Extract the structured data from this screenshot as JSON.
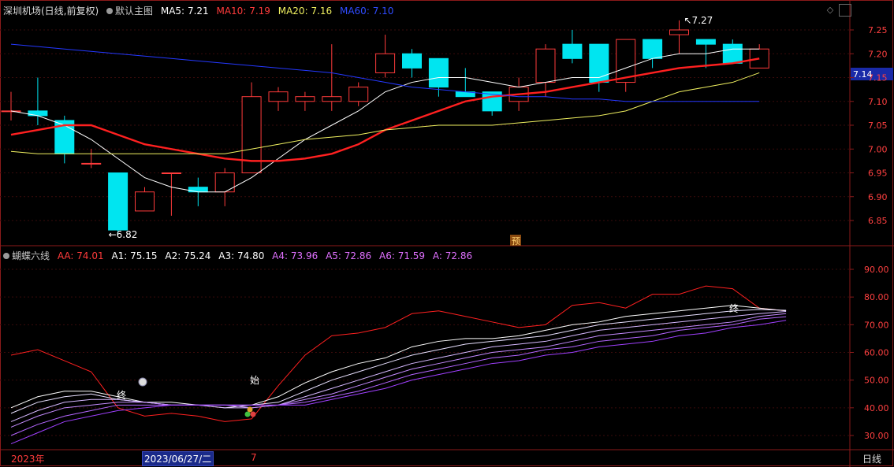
{
  "header": {
    "stock_title": "深圳机场(日线,前复权)",
    "main_chart_label": "默认主图",
    "ma": [
      {
        "label": "MA5:",
        "value": "7.21",
        "color": "#ffffff"
      },
      {
        "label": "MA10:",
        "value": "7.19",
        "color": "#ff3b3b"
      },
      {
        "label": "MA20:",
        "value": "7.16",
        "color": "#f0f060"
      },
      {
        "label": "MA60:",
        "value": "7.10",
        "color": "#2f4bff"
      }
    ]
  },
  "indicator": {
    "name": "蝴蝶六线",
    "values": [
      {
        "label": "AA:",
        "value": "74.01",
        "color": "#ff3b3b"
      },
      {
        "label": "A1:",
        "value": "75.15",
        "color": "#ffffff"
      },
      {
        "label": "A2:",
        "value": "75.24",
        "color": "#ffffff"
      },
      {
        "label": "A3:",
        "value": "74.80",
        "color": "#ffffff"
      },
      {
        "label": "A4:",
        "value": "73.96",
        "color": "#e070ff"
      },
      {
        "label": "A5:",
        "value": "72.86",
        "color": "#e070ff"
      },
      {
        "label": "A6:",
        "value": "71.59",
        "color": "#e070ff"
      },
      {
        "label": "A:",
        "value": "72.86",
        "color": "#e070ff"
      }
    ]
  },
  "footer": {
    "year_label": "2023年",
    "cursor_date": "2023/06/27/二",
    "month_label": "7",
    "period_button": "日线"
  },
  "colors": {
    "up": "#ff3b3b",
    "down": "#00e5f0",
    "ma5": "#ffffff",
    "ma10": "#ff2020",
    "ma20": "#f0f060",
    "ma60": "#2438ff",
    "frame": "#8b1a1a"
  },
  "chart_data": [
    {
      "type": "candlestick",
      "ylim": [
        6.8,
        7.28
      ],
      "yticks": [
        "7.25",
        "7.20",
        "7.15",
        "7.10",
        "7.05",
        "7.00",
        "6.95",
        "6.90",
        "6.85"
      ],
      "current_price_label": "7.14",
      "annotations": {
        "high": "7.27",
        "low": "6.82",
        "forecast_tag": "预"
      },
      "candles": [
        {
          "o": 7.08,
          "h": 7.12,
          "l": 7.06,
          "c": 7.08
        },
        {
          "o": 7.08,
          "h": 7.15,
          "l": 7.05,
          "c": 7.07
        },
        {
          "o": 7.06,
          "h": 7.07,
          "l": 6.97,
          "c": 6.99
        },
        {
          "o": 6.97,
          "h": 7.0,
          "l": 6.96,
          "c": 6.97
        },
        {
          "o": 6.95,
          "h": 6.95,
          "l": 6.82,
          "c": 6.83
        },
        {
          "o": 6.87,
          "h": 6.92,
          "l": 6.87,
          "c": 6.91
        },
        {
          "o": 6.95,
          "h": 6.95,
          "l": 6.86,
          "c": 6.95
        },
        {
          "o": 6.92,
          "h": 6.94,
          "l": 6.88,
          "c": 6.91
        },
        {
          "o": 6.91,
          "h": 6.96,
          "l": 6.88,
          "c": 6.95
        },
        {
          "o": 6.95,
          "h": 7.14,
          "l": 6.95,
          "c": 7.11
        },
        {
          "o": 7.1,
          "h": 7.13,
          "l": 7.08,
          "c": 7.12
        },
        {
          "o": 7.1,
          "h": 7.12,
          "l": 7.08,
          "c": 7.11
        },
        {
          "o": 7.1,
          "h": 7.22,
          "l": 7.08,
          "c": 7.11
        },
        {
          "o": 7.1,
          "h": 7.14,
          "l": 7.09,
          "c": 7.13
        },
        {
          "o": 7.16,
          "h": 7.24,
          "l": 7.15,
          "c": 7.2
        },
        {
          "o": 7.2,
          "h": 7.21,
          "l": 7.15,
          "c": 7.17
        },
        {
          "o": 7.19,
          "h": 7.19,
          "l": 7.11,
          "c": 7.13
        },
        {
          "o": 7.12,
          "h": 7.17,
          "l": 7.11,
          "c": 7.11
        },
        {
          "o": 7.12,
          "h": 7.12,
          "l": 7.07,
          "c": 7.08
        },
        {
          "o": 7.1,
          "h": 7.15,
          "l": 7.08,
          "c": 7.13
        },
        {
          "o": 7.14,
          "h": 7.22,
          "l": 7.11,
          "c": 7.21
        },
        {
          "o": 7.22,
          "h": 7.25,
          "l": 7.18,
          "c": 7.19
        },
        {
          "o": 7.22,
          "h": 7.22,
          "l": 7.12,
          "c": 7.14
        },
        {
          "o": 7.14,
          "h": 7.23,
          "l": 7.12,
          "c": 7.23
        },
        {
          "o": 7.23,
          "h": 7.23,
          "l": 7.17,
          "c": 7.19
        },
        {
          "o": 7.24,
          "h": 7.27,
          "l": 7.2,
          "c": 7.25
        },
        {
          "o": 7.23,
          "h": 7.23,
          "l": 7.17,
          "c": 7.22
        },
        {
          "o": 7.22,
          "h": 7.23,
          "l": 7.18,
          "c": 7.18
        },
        {
          "o": 7.17,
          "h": 7.22,
          "l": 7.17,
          "c": 7.21
        }
      ],
      "ma_series": [
        {
          "name": "MA5",
          "values": [
            7.08,
            7.07,
            7.05,
            7.02,
            6.98,
            6.94,
            6.92,
            6.91,
            6.91,
            6.94,
            6.98,
            7.02,
            7.05,
            7.08,
            7.12,
            7.14,
            7.15,
            7.15,
            7.14,
            7.13,
            7.14,
            7.15,
            7.15,
            7.17,
            7.19,
            7.2,
            7.2,
            7.21,
            7.21
          ]
        },
        {
          "name": "MA10",
          "values": [
            7.03,
            7.04,
            7.05,
            7.05,
            7.03,
            7.01,
            7.0,
            6.99,
            6.98,
            6.975,
            6.975,
            6.98,
            6.99,
            7.01,
            7.04,
            7.06,
            7.08,
            7.1,
            7.11,
            7.115,
            7.12,
            7.13,
            7.14,
            7.15,
            7.16,
            7.17,
            7.175,
            7.18,
            7.19
          ]
        },
        {
          "name": "MA20",
          "values": [
            6.995,
            6.99,
            6.99,
            6.99,
            6.99,
            6.99,
            6.99,
            6.99,
            6.99,
            7.0,
            7.01,
            7.02,
            7.025,
            7.03,
            7.04,
            7.045,
            7.05,
            7.05,
            7.05,
            7.055,
            7.06,
            7.065,
            7.07,
            7.08,
            7.1,
            7.12,
            7.13,
            7.14,
            7.16
          ]
        },
        {
          "name": "MA60",
          "values": [
            7.22,
            7.215,
            7.21,
            7.205,
            7.2,
            7.195,
            7.19,
            7.185,
            7.18,
            7.175,
            7.17,
            7.165,
            7.16,
            7.15,
            7.14,
            7.13,
            7.125,
            7.12,
            7.115,
            7.11,
            7.11,
            7.105,
            7.105,
            7.1,
            7.1,
            7.1,
            7.1,
            7.1,
            7.1
          ]
        }
      ]
    },
    {
      "type": "line",
      "ylim": [
        25,
        97
      ],
      "yticks": [
        "90.00",
        "80.00",
        "70.00",
        "60.00",
        "50.00",
        "40.00",
        "30.00"
      ],
      "annotations": {
        "end1": "终",
        "start": "始",
        "end2": "终"
      },
      "series": [
        {
          "name": "AA",
          "values": [
            59,
            61,
            57,
            53,
            40,
            37,
            38,
            37,
            35,
            36,
            48,
            59,
            66,
            67,
            69,
            74,
            75,
            73,
            71,
            69,
            70,
            77,
            78,
            76,
            81,
            81,
            84,
            83,
            76,
            75
          ]
        },
        {
          "name": "A1",
          "values": [
            40,
            44,
            46,
            46,
            44,
            42,
            42,
            41,
            40,
            41,
            44,
            49,
            53,
            56,
            58,
            62,
            64,
            65,
            65,
            66,
            68,
            70,
            71,
            73,
            74,
            75,
            76,
            77,
            76,
            75
          ]
        },
        {
          "name": "A2",
          "values": [
            38,
            42,
            44,
            45,
            43,
            42,
            41,
            41,
            41,
            41,
            42,
            46,
            50,
            53,
            56,
            59,
            61,
            63,
            64,
            65,
            66,
            68,
            70,
            71,
            72,
            73,
            74,
            75,
            75.5,
            75.2
          ]
        },
        {
          "name": "A3",
          "values": [
            35,
            39,
            42,
            43,
            43,
            42,
            41,
            41,
            40,
            40,
            41,
            44,
            47,
            50,
            53,
            56,
            58,
            60,
            62,
            63,
            64,
            66,
            68,
            69,
            70,
            71,
            72,
            73,
            74,
            74.8
          ]
        },
        {
          "name": "A4",
          "values": [
            33,
            37,
            40,
            41,
            42,
            42,
            41,
            41,
            41,
            40,
            41,
            43,
            45,
            48,
            51,
            54,
            56,
            58,
            60,
            61,
            62,
            64,
            66,
            67,
            68,
            69,
            70,
            71,
            73,
            74
          ]
        },
        {
          "name": "A5",
          "values": [
            30,
            34,
            37,
            39,
            41,
            41,
            41,
            41,
            41,
            41,
            41,
            42,
            44,
            46,
            49,
            52,
            54,
            56,
            58,
            59,
            61,
            62,
            64,
            65,
            66,
            68,
            69,
            70,
            72,
            72.9
          ]
        },
        {
          "name": "A6",
          "values": [
            27,
            31,
            35,
            37,
            39,
            40,
            41,
            41,
            41,
            41,
            41,
            41,
            43,
            45,
            47,
            50,
            52,
            54,
            56,
            57,
            59,
            60,
            62,
            63,
            64,
            66,
            67,
            69,
            70,
            71.6
          ]
        }
      ]
    }
  ]
}
